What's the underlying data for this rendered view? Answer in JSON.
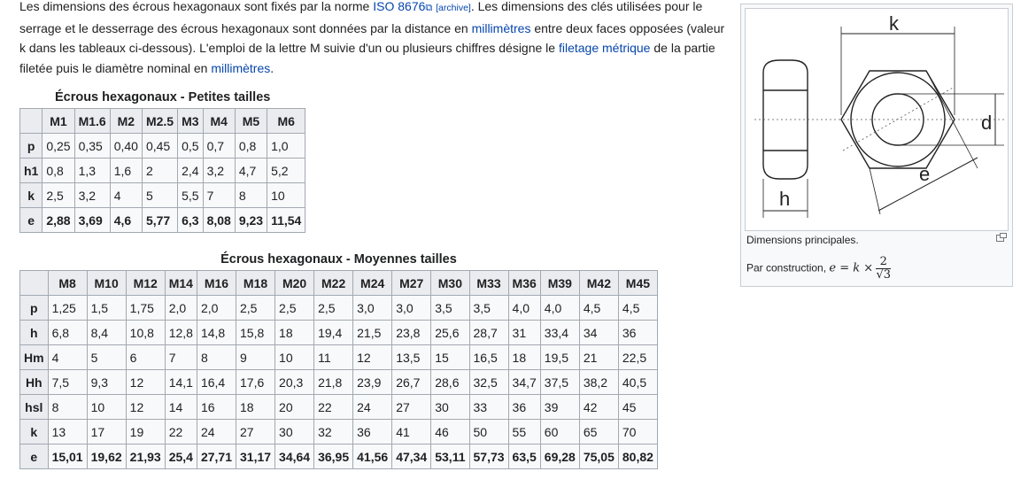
{
  "paragraph": {
    "t1": "Les dimensions des écrous hexagonaux sont fixés par la norme ",
    "iso_link": "ISO 8676",
    "archive": "[archive]",
    "t2": ". Les dimensions des clés utilisées pour le serrage et le desserrage des écrous hexagonaux sont données par la distance en ",
    "mm_link1": "millimètres",
    "t3": " entre deux faces opposées (valeur k dans les tableaux ci-dessous). L'emploi de la lettre M suivie d'un ou plusieurs chiffres désigne le ",
    "filetage_link": "filetage métrique",
    "t4": " de la partie filetée puis le diamètre nominal en ",
    "mm_link2": "millimètres",
    "t5": "."
  },
  "table_small": {
    "caption": "Écrous hexagonaux - Petites tailles",
    "headers": [
      "",
      "M1",
      "M1.6",
      "M2",
      "M2.5",
      "M3",
      "M4",
      "M5",
      "M6"
    ],
    "rows": [
      [
        "p",
        "0,25",
        "0,35",
        "0,40",
        "0,45",
        "0,5",
        "0,7",
        "0,8",
        "1,0"
      ],
      [
        "h1",
        "0,8",
        "1,3",
        "1,6",
        "2",
        "2,4",
        "3,2",
        "4,7",
        "5,2"
      ],
      [
        "k",
        "2,5",
        "3,2",
        "4",
        "5",
        "5,5",
        "7",
        "8",
        "10"
      ],
      [
        "e",
        "2,88",
        "3,69",
        "4,6",
        "5,77",
        "6,3",
        "8,08",
        "9,23",
        "11,54"
      ]
    ]
  },
  "table_medium": {
    "caption": "Écrous hexagonaux - Moyennes tailles",
    "headers": [
      "",
      "M8",
      "M10",
      "M12",
      "M14",
      "M16",
      "M18",
      "M20",
      "M22",
      "M24",
      "M27",
      "M30",
      "M33",
      "M36",
      "M39",
      "M42",
      "M45"
    ],
    "rows": [
      [
        "p",
        "1,25",
        "1,5",
        "1,75",
        "2,0",
        "2,0",
        "2,5",
        "2,5",
        "2,5",
        "3,0",
        "3,0",
        "3,5",
        "3,5",
        "4,0",
        "4,0",
        "4,5",
        "4,5"
      ],
      [
        "h",
        "6,8",
        "8,4",
        "10,8",
        "12,8",
        "14,8",
        "15,8",
        "18",
        "19,4",
        "21,5",
        "23,8",
        "25,6",
        "28,7",
        "31",
        "33,4",
        "34",
        "36"
      ],
      [
        "Hm",
        "4",
        "5",
        "6",
        "7",
        "8",
        "9",
        "10",
        "11",
        "12",
        "13,5",
        "15",
        "16,5",
        "18",
        "19,5",
        "21",
        "22,5"
      ],
      [
        "Hh",
        "7,5",
        "9,3",
        "12",
        "14,1",
        "16,4",
        "17,6",
        "20,3",
        "21,8",
        "23,9",
        "26,7",
        "28,6",
        "32,5",
        "34,7",
        "37,5",
        "38,2",
        "40,5"
      ],
      [
        "hsl",
        "8",
        "10",
        "12",
        "14",
        "16",
        "18",
        "20",
        "22",
        "24",
        "27",
        "30",
        "33",
        "36",
        "39",
        "42",
        "45"
      ],
      [
        "k",
        "13",
        "17",
        "19",
        "22",
        "24",
        "27",
        "30",
        "32",
        "36",
        "41",
        "46",
        "50",
        "55",
        "60",
        "65",
        "70"
      ],
      [
        "e",
        "15,01",
        "19,62",
        "21,93",
        "25,4",
        "27,71",
        "31,17",
        "34,64",
        "36,95",
        "41,56",
        "47,34",
        "53,11",
        "57,73",
        "63,5",
        "69,28",
        "75,05",
        "80,82"
      ]
    ]
  },
  "figure": {
    "label_k": "k",
    "label_d": "d",
    "label_e": "e",
    "label_h": "h",
    "caption": "Dimensions principales.",
    "formula_prefix": "Par construction, ",
    "formula_lhs": "e = k ×",
    "formula_num": "2",
    "formula_den": "√3"
  }
}
